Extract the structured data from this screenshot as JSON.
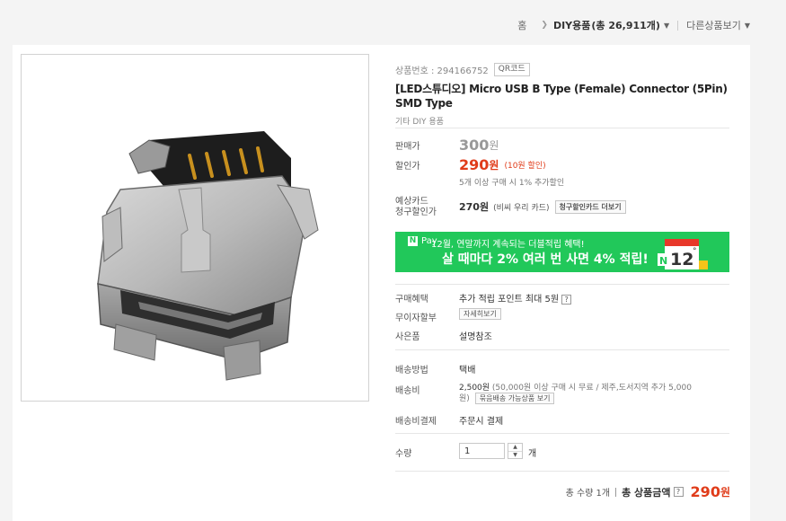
{
  "breadcrumb": {
    "home": "홈",
    "category": "DIY용품",
    "count": "(총 26,911개)",
    "other": "다른상품보기"
  },
  "product": {
    "number_label": "상품번호 : 294166752",
    "qr_label": "QR코드",
    "title": "[LED스튜디오] Micro USB B Type (Female) Connector (5Pin) SMD Type",
    "subcategory": "기타 DIY 용품"
  },
  "price": {
    "label": "판매가",
    "value": "300",
    "unit": "원"
  },
  "sale": {
    "label": "할인가",
    "value": "290",
    "unit": "원",
    "note": "(10원 할인)",
    "extra": "5개 이상 구매 시 1% 추가할인"
  },
  "card": {
    "label_line1": "예상카드",
    "label_line2": "청구할인가",
    "value": "270원",
    "note": "(비씨 우리 카드)",
    "button": "청구할인카드 더보기"
  },
  "banner": {
    "pay": "Pay",
    "top_text": "12월, 연말까지 계속되는 더블적립 혜택!",
    "main_text": "살 때마다 2% 여러 번 사면 4% 적립!",
    "calendar_month": "12",
    "accent": "#21c85a"
  },
  "benefits": {
    "purchase_label": "구매혜택",
    "purchase_value": "추가 적립 포인트 최대 5원",
    "installment_label": "무이자할부",
    "installment_button": "자세히보기",
    "gift_label": "사은품",
    "gift_value": "설명참조"
  },
  "shipping": {
    "method_label": "배송방법",
    "method_value": "택배",
    "fee_label": "배송비",
    "fee_value": "2,500원",
    "fee_note_line1": "(50,000원 이상 구매 시 무료 / 제주,도서지역 추가 5,000",
    "fee_note_line2": "원)",
    "fee_button": "묶음배송 가능상품 보기",
    "payment_label": "배송비결제",
    "payment_value": "주문시 결제"
  },
  "quantity": {
    "label": "수량",
    "value": "1",
    "unit": "개"
  },
  "total": {
    "qty_text": "총 수량 1개",
    "label": "총 상품금액",
    "value": "290",
    "unit": "원",
    "price_color": "#e03c1a"
  }
}
